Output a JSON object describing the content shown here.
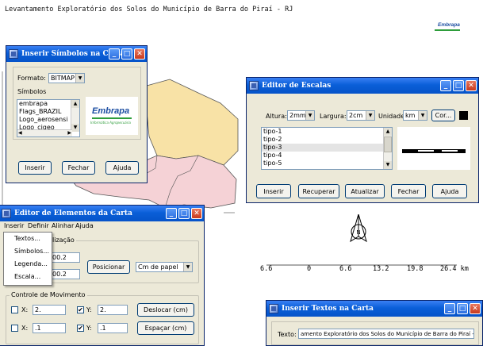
{
  "map": {
    "title": "Levantamento Exploratório dos Solos do Município de Barra do Piraí - RJ",
    "colors": {
      "yellow_region": "#f8e2a6",
      "pink_region": "#f5d2d6",
      "border": "#555555"
    },
    "scale_labels": [
      "6.6",
      "0",
      "6.6",
      "13.2",
      "19.8",
      "26.4 km"
    ],
    "north_arrow_label": "N"
  },
  "simbolos_window": {
    "title": "Inserir Símbolos na Carta",
    "formato_label": "Formato:",
    "formato_value": "BITMAP",
    "simbolos_label": "Símbolos",
    "items": [
      "embrapa",
      "Flags_BRAZIL",
      "Logo_aerosensi",
      "Logo_cigeo"
    ],
    "preview_text": "Embrapa",
    "preview_caption": "Informática Agropecuária",
    "btn_inserir": "Inserir",
    "btn_fechar": "Fechar",
    "btn_ajuda": "Ajuda"
  },
  "escalas_window": {
    "title": "Editor de Escalas",
    "altura_label": "Altura:",
    "altura_value": "2mm",
    "largura_label": "Largura:",
    "largura_value": "2cm",
    "unidade_label": "Unidade:",
    "unidade_value": "km",
    "cor_button": "Cor...",
    "items": [
      "tipo-1",
      "tipo-2",
      "tipo-3",
      "tipo-4",
      "tipo-5"
    ],
    "selected_index": 2,
    "btn_inserir": "Inserir",
    "btn_recuperar": "Recuperar",
    "btn_atualizar": "Atualizar",
    "btn_fechar": "Fechar",
    "btn_ajuda": "Ajuda"
  },
  "elementos_window": {
    "title": "Editor de Elementos da Carta",
    "menu": [
      "Inserir",
      "Definir",
      "Alinhar",
      "Ajuda"
    ],
    "menu_popup": [
      "Textos...",
      "Símbolos...",
      "Legenda...",
      "Escala..."
    ],
    "group_localizacao": "lização",
    "loc_x_value": "00.2",
    "loc_y_value": "00.2",
    "btn_posicionar": "Posicionar",
    "combo_value": "Cm de papel",
    "group_movimento": "Controle de Movimento",
    "x_label": "X:",
    "y_label": "Y:",
    "mov_x1": "2.",
    "mov_y1": "2.",
    "mov_x2": ".1",
    "mov_y2": ".1",
    "check_mark": "✔",
    "btn_deslocar": "Deslocar (cm)",
    "btn_espacar": "Espaçar (cm)"
  },
  "textos_window": {
    "title": "Inserir Textos na Carta",
    "texto_label": "Texto:",
    "texto_value": "amento Exploratório dos Solos do Município de Barra do Piraí - RJ"
  },
  "corner_logo": {
    "text": "Embrapa"
  },
  "window_buttons": {
    "minimize": "_",
    "maximize": "□",
    "close": "✕"
  }
}
